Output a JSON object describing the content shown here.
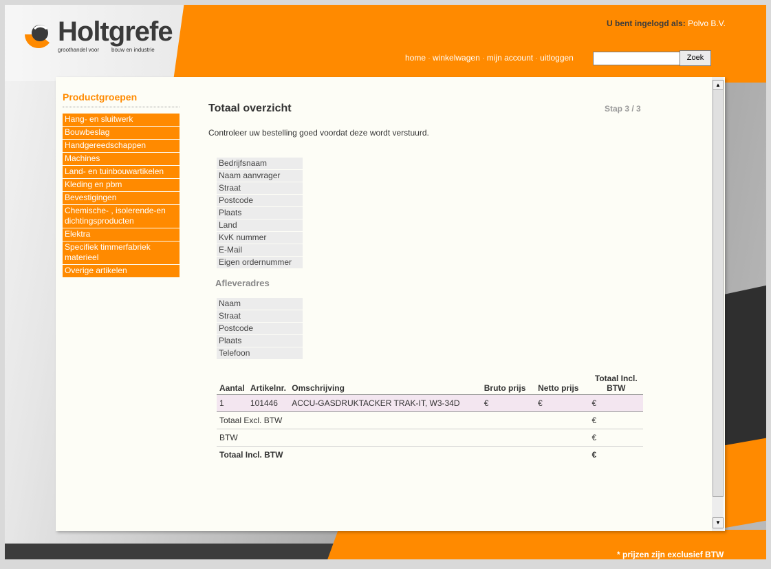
{
  "brand": {
    "name": "Holtgrefe",
    "tagline_left": "groothandel voor",
    "tagline_right": "bouw en industrie"
  },
  "header": {
    "login_label": "U bent ingelogd als:",
    "login_user": "Polvo B.V.",
    "nav": [
      "home",
      "winkelwagen",
      "mijn account",
      "uitloggen"
    ],
    "search": {
      "value": "",
      "button": "Zoek"
    }
  },
  "sidebar": {
    "title": "Productgroepen",
    "items": [
      "Hang- en sluitwerk",
      "Bouwbeslag",
      "Handgereedschappen",
      "Machines",
      "Land- en tuinbouwartikelen",
      "Kleding en pbm",
      "Bevestigingen",
      "Chemische- , isolerende-en dichtingsproducten",
      "Elektra",
      "Specifiek timmerfabriek materieel",
      "Overige artikelen"
    ]
  },
  "main": {
    "title": "Totaal overzicht",
    "step": "Stap 3 / 3",
    "intro": "Controleer uw bestelling goed voordat deze wordt verstuurd.",
    "company_fields": [
      "Bedrijfsnaam",
      "Naam aanvrager",
      "Straat",
      "Postcode",
      "Plaats",
      "Land",
      "KvK nummer",
      "E-Mail",
      "Eigen ordernummer"
    ],
    "delivery_heading": "Afleveradres",
    "delivery_fields": [
      "Naam",
      "Straat",
      "Postcode",
      "Plaats",
      "Telefoon"
    ],
    "order": {
      "headers": [
        "Aantal",
        "Artikelnr.",
        "Omschrijving",
        "Bruto prijs",
        "Netto prijs",
        "Totaal Incl. BTW"
      ],
      "items": [
        {
          "qty": "1",
          "article": "101446",
          "description": "ACCU-GASDRUKTACKER TRAK-IT, W3-34D",
          "bruto": "€",
          "netto": "€",
          "total": "€"
        }
      ],
      "summary": [
        {
          "label": "Totaal Excl. BTW",
          "value": "€"
        },
        {
          "label": "BTW",
          "value": "€"
        },
        {
          "label": "Totaal Incl. BTW",
          "value": "€"
        }
      ]
    }
  },
  "footer": {
    "note": "* prijzen zijn exclusief BTW"
  },
  "colors": {
    "accent": "#ff8a00",
    "panel": "#fdfdf6",
    "field_bg": "#ececec"
  }
}
